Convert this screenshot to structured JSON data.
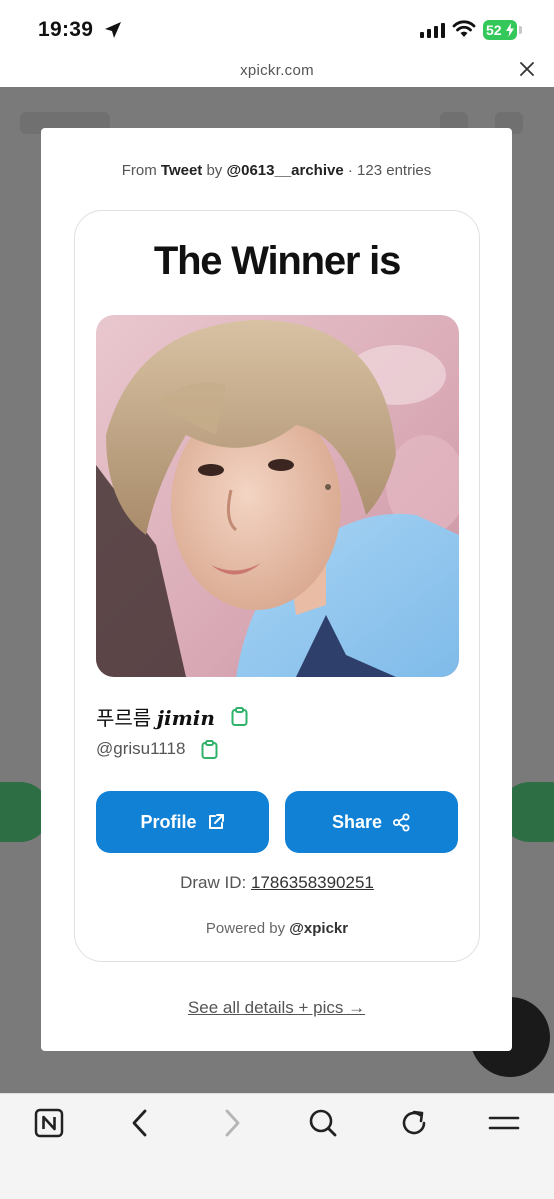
{
  "status_bar": {
    "time": "19:39",
    "battery": "52",
    "battery_color": "#34c759"
  },
  "browser": {
    "url": "xpickr.com",
    "close_icon": "close-icon"
  },
  "modal": {
    "source": {
      "from": "From",
      "source_type": "Tweet",
      "by": "by",
      "account": "@0613__archive",
      "entries": "· 123 entries"
    },
    "title": "The Winner is",
    "winner": {
      "name_prefix": "푸르름",
      "name_styled": "jimin",
      "handle": "@grisu1118"
    },
    "buttons": {
      "profile_label": "Profile",
      "share_label": "Share"
    },
    "draw": {
      "label": "Draw ID:",
      "id": "1786358390251"
    },
    "powered": {
      "label": "Powered by",
      "account": "@xpickr"
    },
    "see_all": "See all details + pics →"
  },
  "colors": {
    "accent": "#1181d6",
    "copy_icon": "#2fb36b"
  },
  "toolbar": {
    "items": [
      "n-app-icon",
      "back-icon",
      "forward-icon",
      "search-icon",
      "reload-icon",
      "menu-icon"
    ]
  }
}
